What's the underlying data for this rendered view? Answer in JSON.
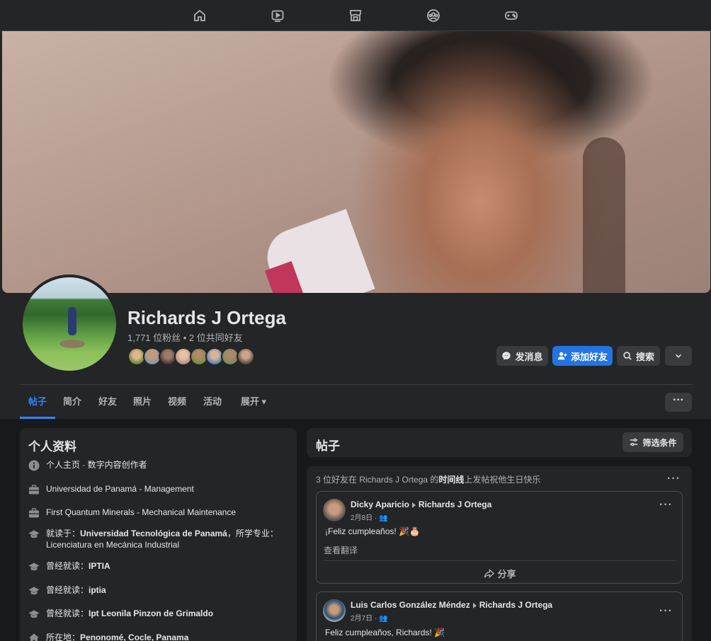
{
  "topnav": {
    "icons": [
      "home-icon",
      "video-icon",
      "marketplace-icon",
      "groups-icon",
      "gaming-icon"
    ]
  },
  "profile": {
    "name": "Richards J Ortega",
    "stats": "1,771 位粉丝 • 2 位共同好友",
    "mutual_friend_count_avatars": 8
  },
  "actions": {
    "message": "发消息",
    "add_friend": "添加好友",
    "search": "搜索"
  },
  "tabs": [
    {
      "label": "帖子",
      "active": true
    },
    {
      "label": "简介"
    },
    {
      "label": "好友"
    },
    {
      "label": "照片"
    },
    {
      "label": "视频"
    },
    {
      "label": "活动"
    },
    {
      "label": "展开 ▾"
    }
  ],
  "more_button": "···",
  "intro": {
    "title": "个人资料",
    "items": [
      {
        "icon": "info-icon",
        "text": "个人主页 · 数字内容创作者"
      },
      {
        "icon": "briefcase-icon",
        "text": "Universidad de Panamá - Management"
      },
      {
        "icon": "briefcase-icon",
        "text": "First Quantum Minerals - Mechanical Maintenance"
      },
      {
        "icon": "graduation-cap-icon",
        "prefix": "就读于：",
        "bold": "Universidad Tecnológica de Panamá",
        "suffix": "，所学专业：",
        "line2": "Licenciatura en Mecánica Industrial"
      },
      {
        "icon": "graduation-cap-icon",
        "prefix": "曾经就读：",
        "bold": "IPTIA"
      },
      {
        "icon": "graduation-cap-icon",
        "prefix": "曾经就读：",
        "bold": "iptia"
      },
      {
        "icon": "graduation-cap-icon",
        "prefix": "曾经就读：",
        "bold": "Ipt Leonila Pinzon de Grimaldo"
      },
      {
        "icon": "home-location-icon",
        "prefix": "所在地：",
        "bold": "Penonomé, Cocle, Panama"
      }
    ]
  },
  "posts_section": {
    "title": "帖子",
    "filter": "筛选条件"
  },
  "feed": {
    "header_prefix": "3 位好友在 Richards J Ortega 的",
    "header_bold": "时间线",
    "header_suffix": "上发帖祝他生日快乐",
    "posts": [
      {
        "author": "Dicky Aparicio",
        "target": "Richards J Ortega",
        "date": "2月8日 · ",
        "text": "¡Feliz cumpleaños! 🎉🎂",
        "translate": "查看翻译",
        "share": "分享"
      },
      {
        "author": "Luis Carlos González Méndez",
        "target": "Richards J Ortega",
        "date": "2月7日 · ",
        "text": "Feliz cumpleaños, Richards! 🎉"
      }
    ]
  },
  "colors": {
    "bg": "#18191a",
    "card": "#242526",
    "accent": "#2374e1",
    "text": "#e4e6eb",
    "muted": "#b0b3b8"
  }
}
